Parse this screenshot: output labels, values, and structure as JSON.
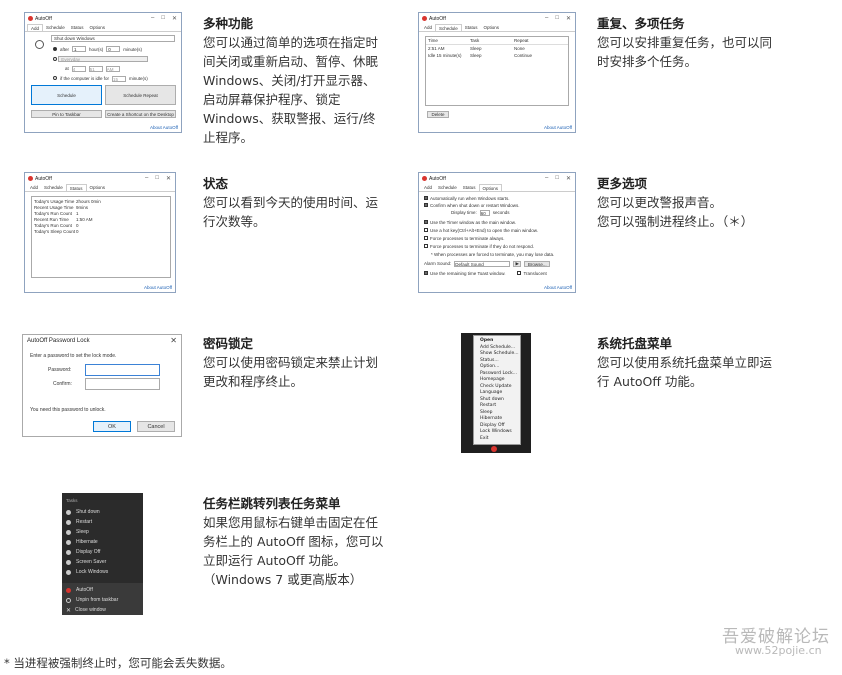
{
  "features": [
    {
      "title": "多种功能",
      "desc": [
        "您可以通过简单的选项在指定时",
        "间关闭或重新启动、暂停、休眠",
        "Windows、关闭/打开显示器、",
        "启动屏幕保护程序、锁定",
        "Windows、获取警报、运行/终",
        "止程序。"
      ]
    },
    {
      "title": "重复、多项任务",
      "desc": [
        "您可以安排重复任务，也可以同",
        "时安排多个任务。"
      ]
    },
    {
      "title": "状态",
      "desc": [
        "您可以看到今天的使用时间、运",
        "行次数等。"
      ]
    },
    {
      "title": "更多选项",
      "desc": [
        "您可以更改警报声音。",
        "您可以强制进程终止。（＊）"
      ]
    },
    {
      "title": "密码锁定",
      "desc": [
        "您可以使用密码锁定来禁止计划",
        "更改和程序终止。"
      ]
    },
    {
      "title": "系统托盘菜单",
      "desc": [
        "您可以使用系统托盘菜单立即运",
        "行 AutoOff 功能。"
      ]
    },
    {
      "title": "任务栏跳转列表任务菜单",
      "desc": [
        "如果您用鼠标右键单击固定在任",
        "务栏上的 AutoOff 图标，您可以",
        "立即运行 AutoOff 功能。",
        "（Windows 7 或更高版本）"
      ]
    }
  ],
  "footnote": "* 当进程被强制终止时，您可能会丢失数据。",
  "watermark": {
    "line1": "吾爱破解论坛",
    "line2": "www.52pojie.cn"
  },
  "app": {
    "title": "AutoOff",
    "tabs": [
      "Add",
      "Schedule",
      "Status",
      "Options"
    ],
    "about": "About AutoOff",
    "add": {
      "action": "Shut down Windows",
      "after": "after",
      "hour_val": "1",
      "hours": "hour(s)",
      "min_val": "0",
      "minutes": "minute(s)",
      "everyday": "Everyday",
      "at": "at",
      "h": "4",
      "m": "51",
      "ampm": "AM",
      "idle": "if the computer is idle for",
      "idle_val": "15",
      "schedule_btn": "Schedule",
      "schedule_repeat_btn": "Schedule Repeat",
      "pin_btn": "Pin to Taskbar",
      "shortcut_btn": "Create a Shortcut on the Desktop"
    },
    "schedule": {
      "headers": [
        "Time",
        "Task",
        "Repeat"
      ],
      "rows": [
        [
          "2:51 AM",
          "Sleep",
          "None"
        ],
        [
          "Idle 15 minute(s)",
          "Sleep",
          "Continue"
        ]
      ],
      "delete_btn": "Delete"
    },
    "status": {
      "rows": [
        [
          "Today's Usage Time",
          "2hours 0min"
        ],
        [
          "Recent Usage Time",
          "9mins"
        ],
        [
          "Today's Run Count",
          "1"
        ],
        [
          "Recent Run Time",
          "1:50 AM"
        ],
        [
          "Today's Run Count",
          "0"
        ],
        [
          "Today's Sleep Count",
          "0"
        ]
      ]
    },
    "options": {
      "items": [
        "Automatically run when Windows starts.",
        "Confirm when shut down or restart Windows.",
        "Use the Timer window as the main window.",
        "Use a hot key(Ctrl+Alt+End) to open the main window.",
        "Force processes to terminate always.",
        "Force processes to terminate if they do not respond."
      ],
      "display_time": "Display time:",
      "display_val": "60",
      "seconds": "seconds",
      "note": "* When processes are forced to terminate, you may lose data.",
      "alarm_sound": "Alarm Sound:",
      "sound_val": "Default Sound",
      "play": "▶",
      "browse": "Browse...",
      "remaining": "Use the remaining time Toast window.",
      "translucent": "Translucent"
    },
    "password": {
      "title": "AutoOff Password Lock",
      "prompt": "Enter a password to set the lock mode.",
      "password_label": "Password:",
      "confirm_label": "Confirm:",
      "unlock_note": "You need this password to unlock.",
      "ok": "OK",
      "cancel": "Cancel"
    },
    "tray": {
      "items": [
        "Open",
        "Add Schedule...",
        "Show Schedule...",
        "Status...",
        "Option...",
        "Password Lock...",
        "Homepage",
        "Check Update",
        "Language",
        "Shut down",
        "Restart",
        "Sleep",
        "Hibernate",
        "Display Off",
        "Lock Windows",
        "Exit"
      ]
    },
    "jumplist": {
      "header": "Tasks",
      "items": [
        "Shut down",
        "Restart",
        "Sleep",
        "Hibernate",
        "Display Off",
        "Screen Saver",
        "Lock Windows"
      ],
      "bottom": [
        "AutoOff",
        "Unpin from taskbar",
        "Close window"
      ]
    }
  }
}
